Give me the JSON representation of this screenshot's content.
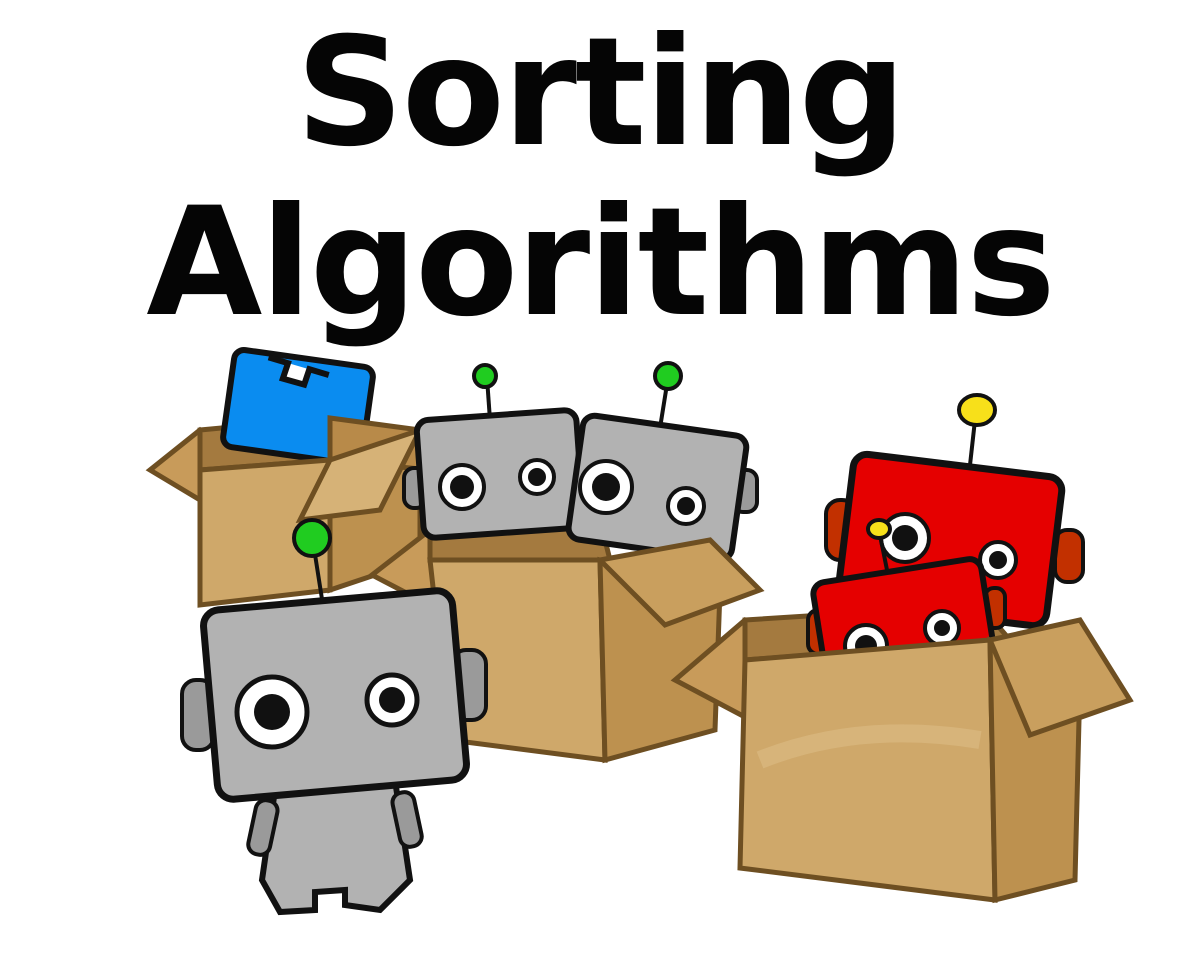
{
  "title": {
    "line1": "Sorting",
    "line2": "Algorithms"
  },
  "colors": {
    "text": "#050505",
    "background": "#ffffff",
    "box": "#cfa86a",
    "box_dark": "#a9804a",
    "box_outline": "#7a5a2c",
    "robot_gray": "#a9a9a9",
    "robot_red": "#e50000",
    "robot_blue": "#0a8cf0",
    "antenna_green": "#20cc20",
    "antenna_yellow": "#f7e01a"
  },
  "illustration": {
    "boxes": [
      "cardboard-box",
      "cardboard-box",
      "cardboard-box"
    ],
    "robots": [
      "blue-robot",
      "gray-robot",
      "gray-robot",
      "gray-robot",
      "red-robot",
      "red-robot"
    ]
  }
}
